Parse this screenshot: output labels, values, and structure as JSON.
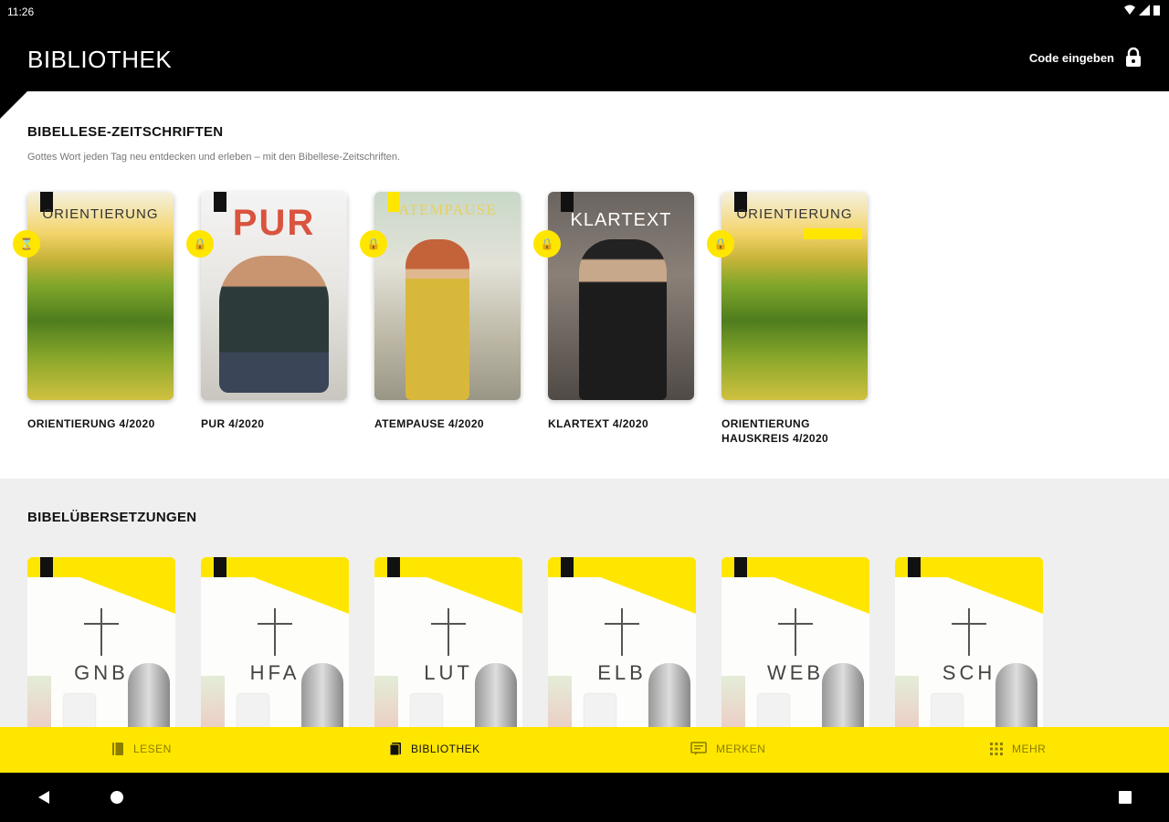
{
  "status": {
    "time": "11:26"
  },
  "appbar": {
    "title": "BIBLIOTHEK",
    "code_label": "Code eingeben"
  },
  "magazines": {
    "title": "BIBELLESE-ZEITSCHRIFTEN",
    "subtitle": "Gottes Wort jeden Tag neu entdecken und erleben – mit den Bibellese-Zeitschriften.",
    "items": [
      {
        "label": "ORIENTIERUNG 4/2020",
        "cover_title": "ORIENTIERUNG",
        "badge": "hourglass-icon"
      },
      {
        "label": "PUR 4/2020",
        "cover_title": "PUR",
        "badge": "lock-icon"
      },
      {
        "label": "ATEMPAUSE 4/2020",
        "cover_title": "ATEMPAUSE",
        "badge": "lock-icon"
      },
      {
        "label": "KLARTEXT 4/2020",
        "cover_title": "KLARTEXT",
        "badge": "lock-icon"
      },
      {
        "label": "ORIENTIERUNG HAUSKREIS 4/2020",
        "cover_title": "ORIENTIERUNG",
        "badge": "lock-icon"
      }
    ]
  },
  "translations": {
    "title": "BIBELÜBERSETZUNGEN",
    "items": [
      {
        "code": "GNB"
      },
      {
        "code": "HFA"
      },
      {
        "code": "LUT"
      },
      {
        "code": "ELB"
      },
      {
        "code": "WEB"
      },
      {
        "code": "SCH"
      }
    ]
  },
  "bottom_nav": [
    {
      "label": "LESEN",
      "icon": "book-icon",
      "active": false
    },
    {
      "label": "BIBLIOTHEK",
      "icon": "library-icon",
      "active": true
    },
    {
      "label": "MERKEN",
      "icon": "bookmark-icon",
      "active": false
    },
    {
      "label": "MEHR",
      "icon": "grid-icon",
      "active": false
    }
  ],
  "colors": {
    "accent": "#ffe600",
    "appbar": "#000000",
    "section_bg": "#efefef"
  }
}
